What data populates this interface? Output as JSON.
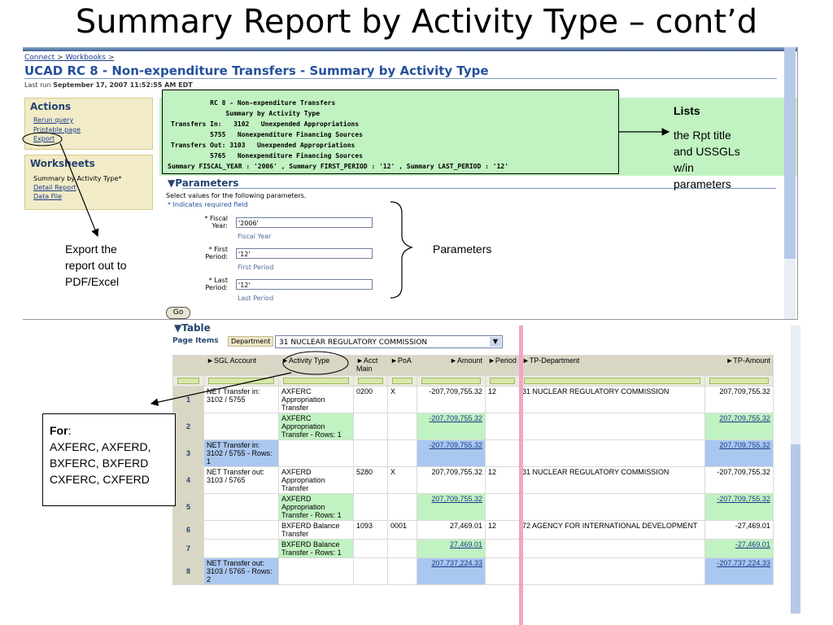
{
  "slide_title": "Summary Report by Activity Type – cont’d",
  "breadcrumb": {
    "connect": "Connect",
    "sep1": ">",
    "workbooks": "Workbooks",
    "sep2": ">"
  },
  "page_heading": "UCAD RC 8 - Non-expenditure Transfers - Summary by Activity Type",
  "last_run_label": "Last run",
  "last_run_value": "September 17, 2007 11:52:55 AM EDT",
  "actions": {
    "title": "Actions",
    "items": [
      "Rerun query",
      "Printable page",
      "Export"
    ]
  },
  "worksheets": {
    "title": "Worksheets",
    "current": "Summary by Activity Type*",
    "links": [
      "Detail Report",
      "Data File"
    ]
  },
  "report_header": {
    "lines": [
      "          RC 8 - Non-expenditure Transfers",
      "              Summary by Activity Type",
      "Transfers In:   3102   Unexpended Appropriations",
      "          5755   Nonexpenditure Financing Sources",
      "Transfers Out: 3103   Unexpended Appropriations",
      "          5765   Nonexpenditure Financing Sources",
      "Summary FISCAL_YEAR : '2006' , Summary FIRST_PERIOD : '12' , Summary LAST_PERIOD : '12'"
    ]
  },
  "parameters": {
    "title": "Parameters",
    "instructions": "Select values for the following parameters.",
    "required_note": "* Indicates required field",
    "fields": [
      {
        "label": "* Fiscal Year:",
        "value": "'2006'",
        "sub": "Fiscal Year"
      },
      {
        "label": "* First Period:",
        "value": "'12'",
        "sub": "First Period"
      },
      {
        "label": "* Last Period:",
        "value": "'12'",
        "sub": "Last Period"
      }
    ],
    "go_label": "Go"
  },
  "callouts": {
    "lists_title": "Lists",
    "lists_body": [
      "the Rpt title",
      "and USSGLs",
      "w/in",
      "parameters"
    ],
    "parameters": "Parameters",
    "export": [
      "Export the",
      "report out to",
      "PDF/Excel"
    ],
    "for_title": "For",
    "for_body": [
      "AXFERC, AXFERD,",
      "BXFERC, BXFERD",
      "CXFERC, CXFERD"
    ]
  },
  "table_section": {
    "title": "Table",
    "page_items_label": "Page Items",
    "department_label": "Department",
    "department_value": "31 NUCLEAR REGULATORY COMMISSION",
    "dropdown_icon": "chevron-down-icon",
    "columns": [
      "SGL Account",
      "Activity Type",
      "Acct Main",
      "PoA",
      "Amount",
      "Period",
      "TP-Department",
      "TP-Amount"
    ],
    "rows": [
      {
        "n": "1",
        "sgl": "NET Transfer in: 3102 / 5755",
        "act": "AXFERC Appropriation Transfer",
        "main": "0200",
        "poa": "X",
        "amt": "-207,709,755.32",
        "per": "12",
        "tpd": "31  NUCLEAR REGULATORY COMMISSION",
        "tpa": "207,709,755.32",
        "style": "plain"
      },
      {
        "n": "2",
        "sgl": "",
        "act": "AXFERC Appropriation Transfer - Rows: 1",
        "main": "",
        "poa": "",
        "amt": "-207,709,755.32",
        "per": "",
        "tpd": "",
        "tpa": "207,709,755.32",
        "style": "subtotal"
      },
      {
        "n": "3",
        "sgl": "NET Transfer in: 3102 / 5755 - Rows: 1",
        "act": "",
        "main": "",
        "poa": "",
        "amt": "-207,709,755.32",
        "per": "",
        "tpd": "",
        "tpa": "207,709,755.32",
        "style": "total"
      },
      {
        "n": "4",
        "sgl": "NET Transfer out: 3103 / 5765",
        "act": "AXFERD Appropriation Transfer",
        "main": "5280",
        "poa": "X",
        "amt": "207,709,755.32",
        "per": "12",
        "tpd": "31  NUCLEAR REGULATORY COMMISSION",
        "tpa": "-207,709,755.32",
        "style": "plain"
      },
      {
        "n": "5",
        "sgl": "",
        "act": "AXFERD Appropriation Transfer - Rows: 1",
        "main": "",
        "poa": "",
        "amt": "207,709,755.32",
        "per": "",
        "tpd": "",
        "tpa": "-207,709,755.32",
        "style": "subtotal"
      },
      {
        "n": "6",
        "sgl": "",
        "act": "BXFERD  Balance Transfer",
        "main": "1093",
        "poa": "0001",
        "amt": "27,469.01",
        "per": "12",
        "tpd": "72  AGENCY FOR INTERNATIONAL DEVELOPMENT",
        "tpa": "-27,469.01",
        "style": "plain"
      },
      {
        "n": "7",
        "sgl": "",
        "act": "BXFERD Balance Transfer - Rows: 1",
        "main": "",
        "poa": "",
        "amt": "27,469.01",
        "per": "",
        "tpd": "",
        "tpa": "-27,469.01",
        "style": "subtotal"
      },
      {
        "n": "8",
        "sgl": "NET Transfer out: 3103 / 5765 - Rows: 2",
        "act": "",
        "main": "",
        "poa": "",
        "amt": "207,737,224.33",
        "per": "",
        "tpd": "",
        "tpa": "-207,737,224.33",
        "style": "total"
      }
    ]
  }
}
